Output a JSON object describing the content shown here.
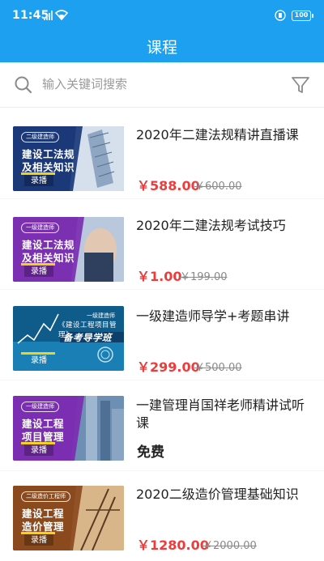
{
  "status": {
    "time": "11:45",
    "battery": "100"
  },
  "header": {
    "title": "课程"
  },
  "search": {
    "placeholder": "输入关键词搜索",
    "icon": "search-icon",
    "filter_icon": "filter-icon"
  },
  "colors": {
    "header": "#1ea0f0",
    "price": "#ef3b3b",
    "strike": "#8a8a8a"
  },
  "courses": [
    {
      "title": "2020年二建法规精讲直播课",
      "price": "￥588.00",
      "original_price": "￥600.00",
      "thumb": {
        "tag": "二级建造师",
        "line1": "建设工法规",
        "line2": "及相关知识",
        "label": "录播",
        "theme": "blue"
      }
    },
    {
      "title": "2020年二建法规考试技巧",
      "price": "￥1.00",
      "original_price": "￥199.00",
      "thumb": {
        "tag": "一级建造师",
        "line1": "建设工法规",
        "line2": "及相关知识",
        "label": "录播",
        "theme": "purple"
      }
    },
    {
      "title": "一级建造师导学+考题串讲",
      "price": "￥299.00",
      "original_price": "￥500.00",
      "thumb": {
        "tag": "一级建造师",
        "line1": "《建设工程项目管理》",
        "line2": "备考导学班",
        "label": "录播",
        "theme": "teal"
      }
    },
    {
      "title": "一建管理肖国祥老师精讲试听课",
      "price": "免费",
      "thumb": {
        "tag": "一级建造师",
        "line1": "建设工程",
        "line2": "项目管理",
        "label": "录播",
        "theme": "purple"
      }
    },
    {
      "title": "2020二级造价管理基础知识",
      "price": "￥1280.00",
      "original_price": "￥2000.00",
      "thumb": {
        "tag": "二级造价工程师",
        "line1": "建设工程",
        "line2": "造价管理",
        "label": "录播",
        "theme": "brown"
      }
    }
  ]
}
